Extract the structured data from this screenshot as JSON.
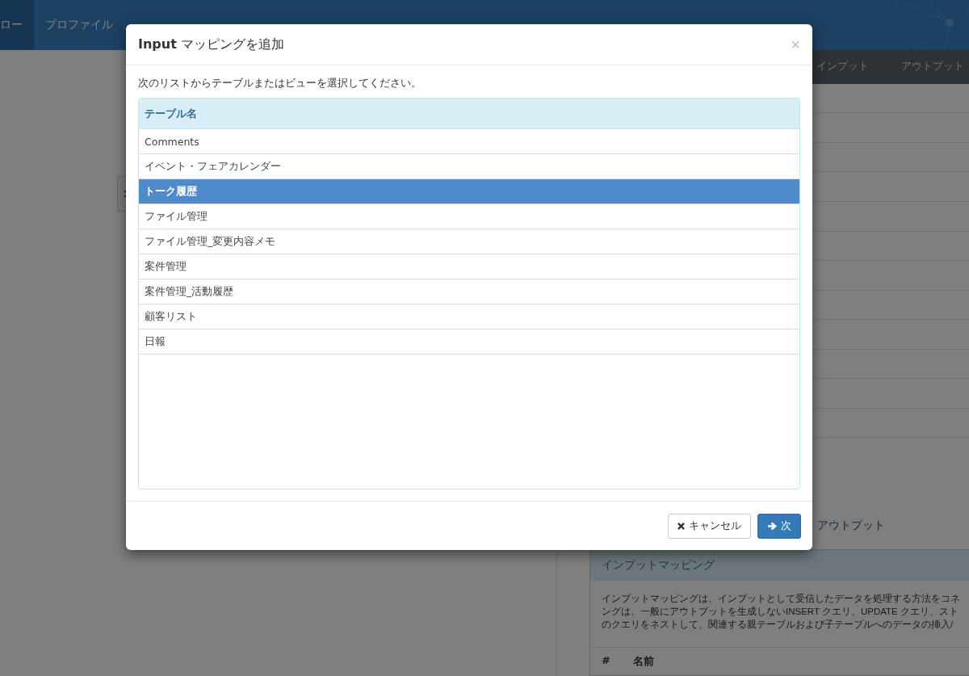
{
  "nav": {
    "items": [
      {
        "label": "ロー",
        "selected": true
      },
      {
        "label": "プロファイル",
        "selected": false
      }
    ]
  },
  "tabs": [
    {
      "label": "インプット",
      "selected": false
    },
    {
      "label": "アウトプット",
      "selected": false
    }
  ],
  "section_link": "アウトプット",
  "mapping_panel": {
    "title": "インプットマッピング",
    "description_lines": [
      "インプットマッピングは、インプットとして受信したデータを処理する方法をコネ",
      "ングは、一般にアウトプットを生成しないINSERT クエリ、UPDATE クエリ、スト",
      "のクエリをネストして、関連する親テーブルおよび子テーブルへのデータの挿入/"
    ],
    "columns": [
      "#",
      "名前"
    ]
  },
  "dialog": {
    "title": "**Input** マッピングを追加",
    "close": "×",
    "instruction": "次のリストからテーブルまたはビューを選択してください。",
    "list_header": "テーブル名",
    "rows": [
      {
        "name": "Comments",
        "selected": false
      },
      {
        "name": "イベント・フェアカレンダー",
        "selected": false
      },
      {
        "name": "トーク履歴",
        "selected": true
      },
      {
        "name": "ファイル管理",
        "selected": false
      },
      {
        "name": "ファイル管理_変更内容メモ",
        "selected": false
      },
      {
        "name": "案件管理",
        "selected": false
      },
      {
        "name": "案件管理_活動履歴",
        "selected": false
      },
      {
        "name": "顧客リスト",
        "selected": false
      },
      {
        "name": "日報",
        "selected": false
      }
    ],
    "buttons": [
      {
        "label": "キャンセル",
        "kind": "cancel"
      },
      {
        "label": "次",
        "kind": "next"
      }
    ]
  }
}
